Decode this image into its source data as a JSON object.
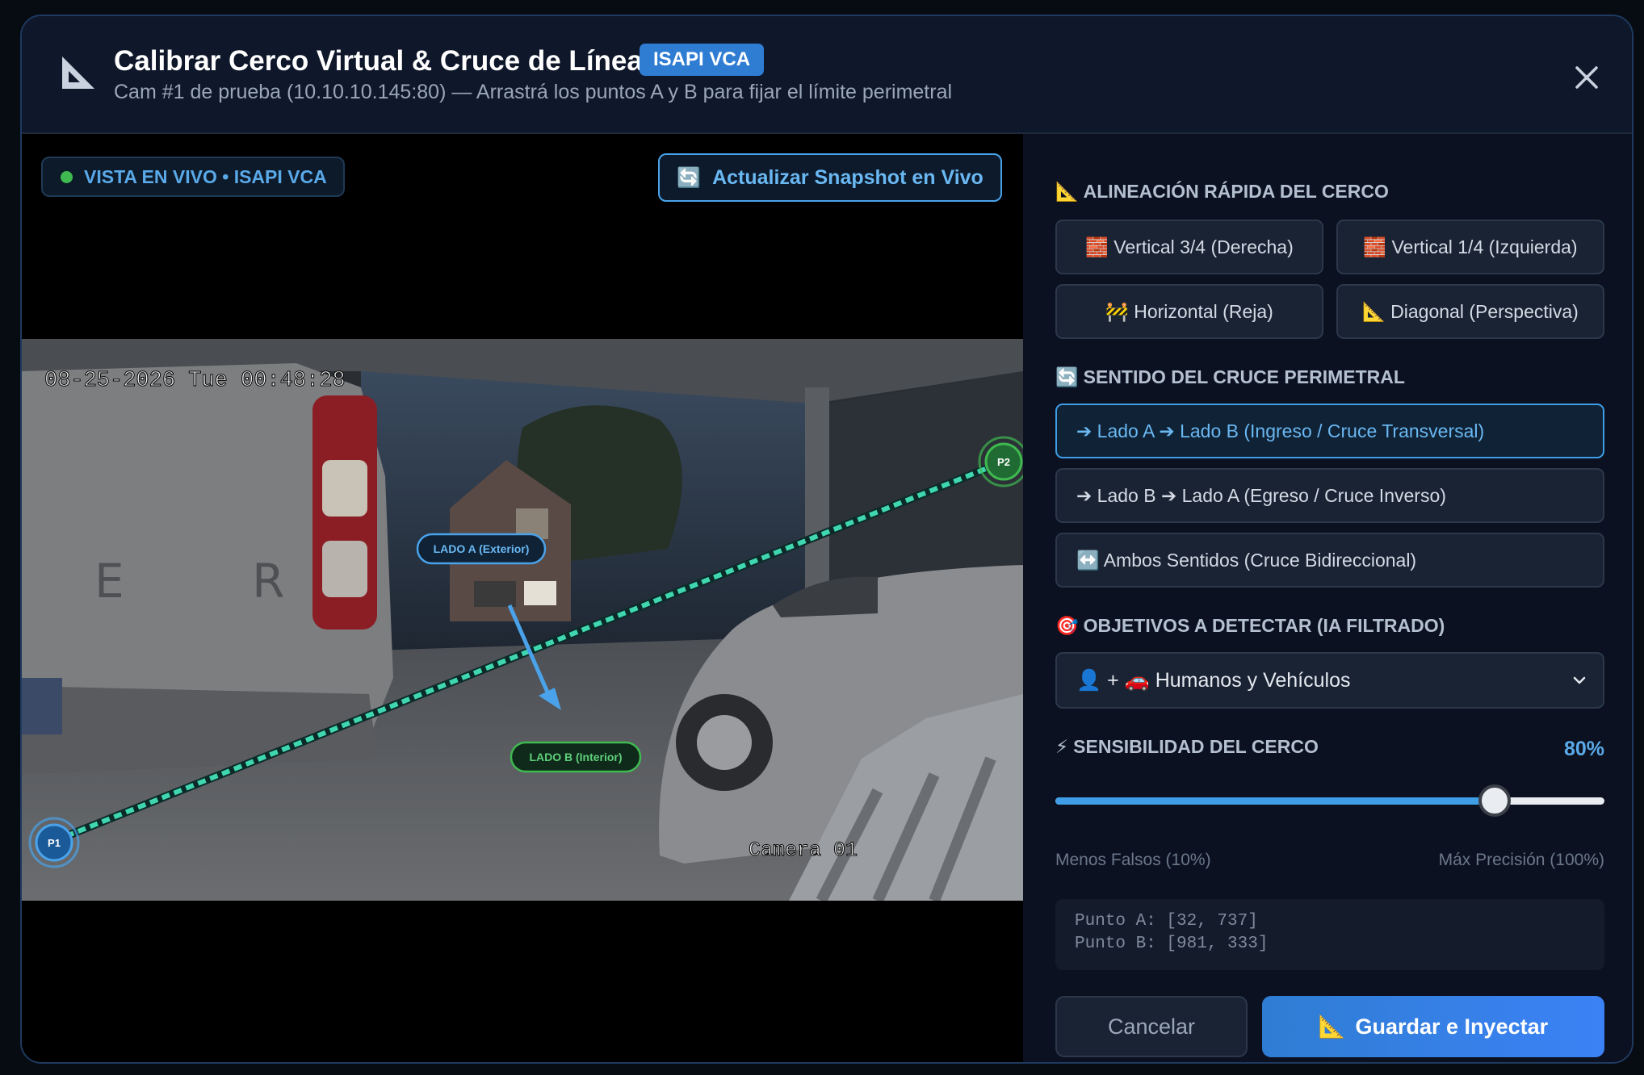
{
  "header": {
    "icon": "set-square-icon",
    "title": "Calibrar Cerco Virtual & Cruce de Línea",
    "badge": "ISAPI VCA",
    "subtitle": "Cam #1 de prueba (10.10.10.145:80) — Arrastrá los puntos A y B para fijar el límite perimetral",
    "close_icon": "close-icon"
  },
  "preview": {
    "live_label": "VISTA EN VIVO • ISAPI VCA",
    "snapshot_icon": "refresh-icon",
    "snapshot_button": "Actualizar Snapshot en Vivo",
    "osd_timestamp": "08-25-2026 Tue 00:48:28",
    "osd_camera": "Camera 01",
    "side_a_label": "LADO A (Exterior)",
    "side_b_label": "LADO B (Interior)",
    "point1_label": "P1",
    "point2_label": "P2",
    "colors": {
      "line": "#3fd6b0",
      "arrow": "#4aa3ea",
      "point1": "#4aa3ea",
      "point2": "#3fb950"
    }
  },
  "alignment": {
    "title_icon": "📐",
    "title": "ALINEACIÓN RÁPIDA DEL CERCO",
    "buttons": [
      {
        "icon": "🧱",
        "label": "Vertical 3/4 (Derecha)"
      },
      {
        "icon": "🧱",
        "label": "Vertical 1/4 (Izquierda)"
      },
      {
        "icon": "🚧",
        "label": "Horizontal (Reja)"
      },
      {
        "icon": "📐",
        "label": "Diagonal (Perspectiva)"
      }
    ]
  },
  "direction": {
    "title_icon": "🔄",
    "title": "SENTIDO DEL CRUCE PERIMETRAL",
    "options": [
      {
        "label": "➔ Lado A ➔ Lado B (Ingreso / Cruce Transversal)",
        "selected": true
      },
      {
        "label": "➔ Lado B ➔ Lado A (Egreso / Cruce Inverso)",
        "selected": false
      },
      {
        "label": "↔️ Ambos Sentidos (Cruce Bidireccional)",
        "selected": false
      }
    ]
  },
  "objects": {
    "title_icon": "🎯",
    "title": "OBJETIVOS A DETECTAR (IA FILTRADO)",
    "selected": "👤 + 🚗 Humanos y Vehículos",
    "chevron_icon": "chevron-down-icon"
  },
  "sensitivity": {
    "title_icon": "⚡",
    "title": "SENSIBILIDAD DEL CERCO",
    "value": 0.8,
    "value_label": "80%",
    "min_label": "Menos Falsos (10%)",
    "max_label": "Máx Precisión (100%)"
  },
  "coords": {
    "point_a": "Punto A: [32, 737]",
    "point_b": "Punto B: [981, 333]"
  },
  "footer": {
    "cancel": "Cancelar",
    "save_icon": "📐",
    "save": "Guardar e Inyectar"
  }
}
